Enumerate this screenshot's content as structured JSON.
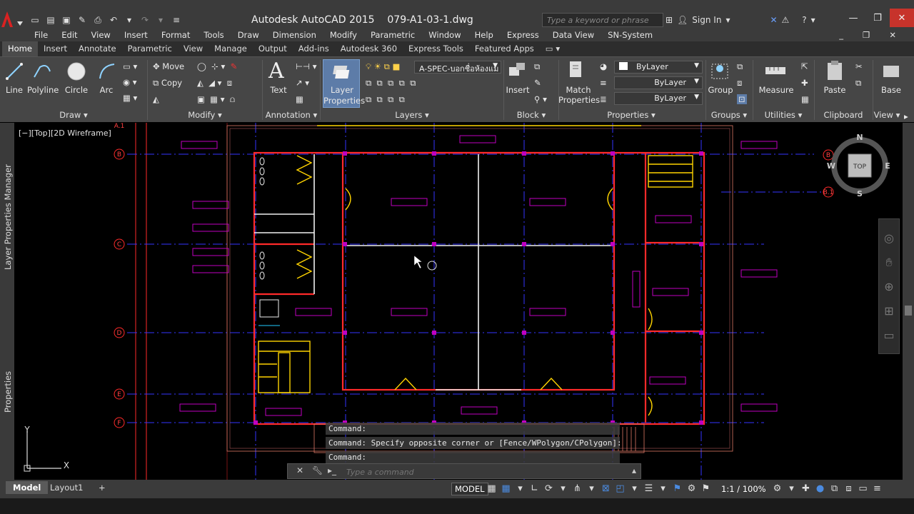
{
  "app": {
    "title": "Autodesk AutoCAD 2015    079-A1-03-1.dwg",
    "search_placeholder": "Type a keyword or phrase",
    "sign_in": "Sign In"
  },
  "menu": [
    "File",
    "Edit",
    "View",
    "Insert",
    "Format",
    "Tools",
    "Draw",
    "Dimension",
    "Modify",
    "Parametric",
    "Window",
    "Help",
    "Express",
    "Data View",
    "SN-System"
  ],
  "ribbon_tabs": [
    "Home",
    "Insert",
    "Annotate",
    "Parametric",
    "View",
    "Manage",
    "Output",
    "Add-ins",
    "Autodesk 360",
    "Express Tools",
    "Featured Apps"
  ],
  "ribbon": {
    "draw": {
      "line": "Line",
      "polyline": "Polyline",
      "circle": "Circle",
      "arc": "Arc",
      "footer": "Draw"
    },
    "modify": {
      "move": "Move",
      "copy": "Copy",
      "footer": "Modify"
    },
    "annotation": {
      "text": "Text",
      "footer": "Annotation"
    },
    "layers": {
      "layer_properties_1": "Layer",
      "layer_properties_2": "Properties",
      "current_layer": "A-SPEC-บอกชื่อห้องแม",
      "footer": "Layers"
    },
    "block": {
      "insert": "Insert",
      "footer": "Block"
    },
    "properties": {
      "match_1": "Match",
      "match_2": "Properties",
      "color": "ByLayer",
      "linetype": "ByLayer",
      "lineweight": "ByLayer",
      "footer": "Properties"
    },
    "groups": {
      "group": "Group",
      "footer": "Groups"
    },
    "utilities": {
      "measure": "Measure",
      "footer": "Utilities"
    },
    "clipboard": {
      "paste": "Paste",
      "footer": "Clipboard"
    },
    "view": {
      "base": "Base",
      "footer": "View"
    }
  },
  "palettes": {
    "layer_manager": "Layer Properties Manager",
    "properties": "Properties"
  },
  "viewport": {
    "label": "[−][Top][2D Wireframe]",
    "viewcube": {
      "top": "TOP",
      "n": "N",
      "s": "S",
      "e": "E",
      "w": "W"
    }
  },
  "ucs": {
    "x": "X",
    "y": "Y"
  },
  "grid_labels": [
    "A.1",
    "B",
    "C",
    "D",
    "E",
    "F",
    "B",
    "B.1"
  ],
  "command": {
    "history": [
      "Command:",
      "Command: Specify opposite corner or [Fence/WPolygon/CPolygon]:",
      "Command:"
    ],
    "placeholder": "Type a command"
  },
  "status": {
    "tabs": [
      "Model",
      "Layout1"
    ],
    "model": "MODEL",
    "scale": "1:1 / 100%"
  },
  "colors": {
    "accent": "#4b8be0",
    "wall": "#ff2a2a",
    "grid": "#3434ff",
    "door": "#ffd400",
    "highlight": "#c000c0"
  }
}
